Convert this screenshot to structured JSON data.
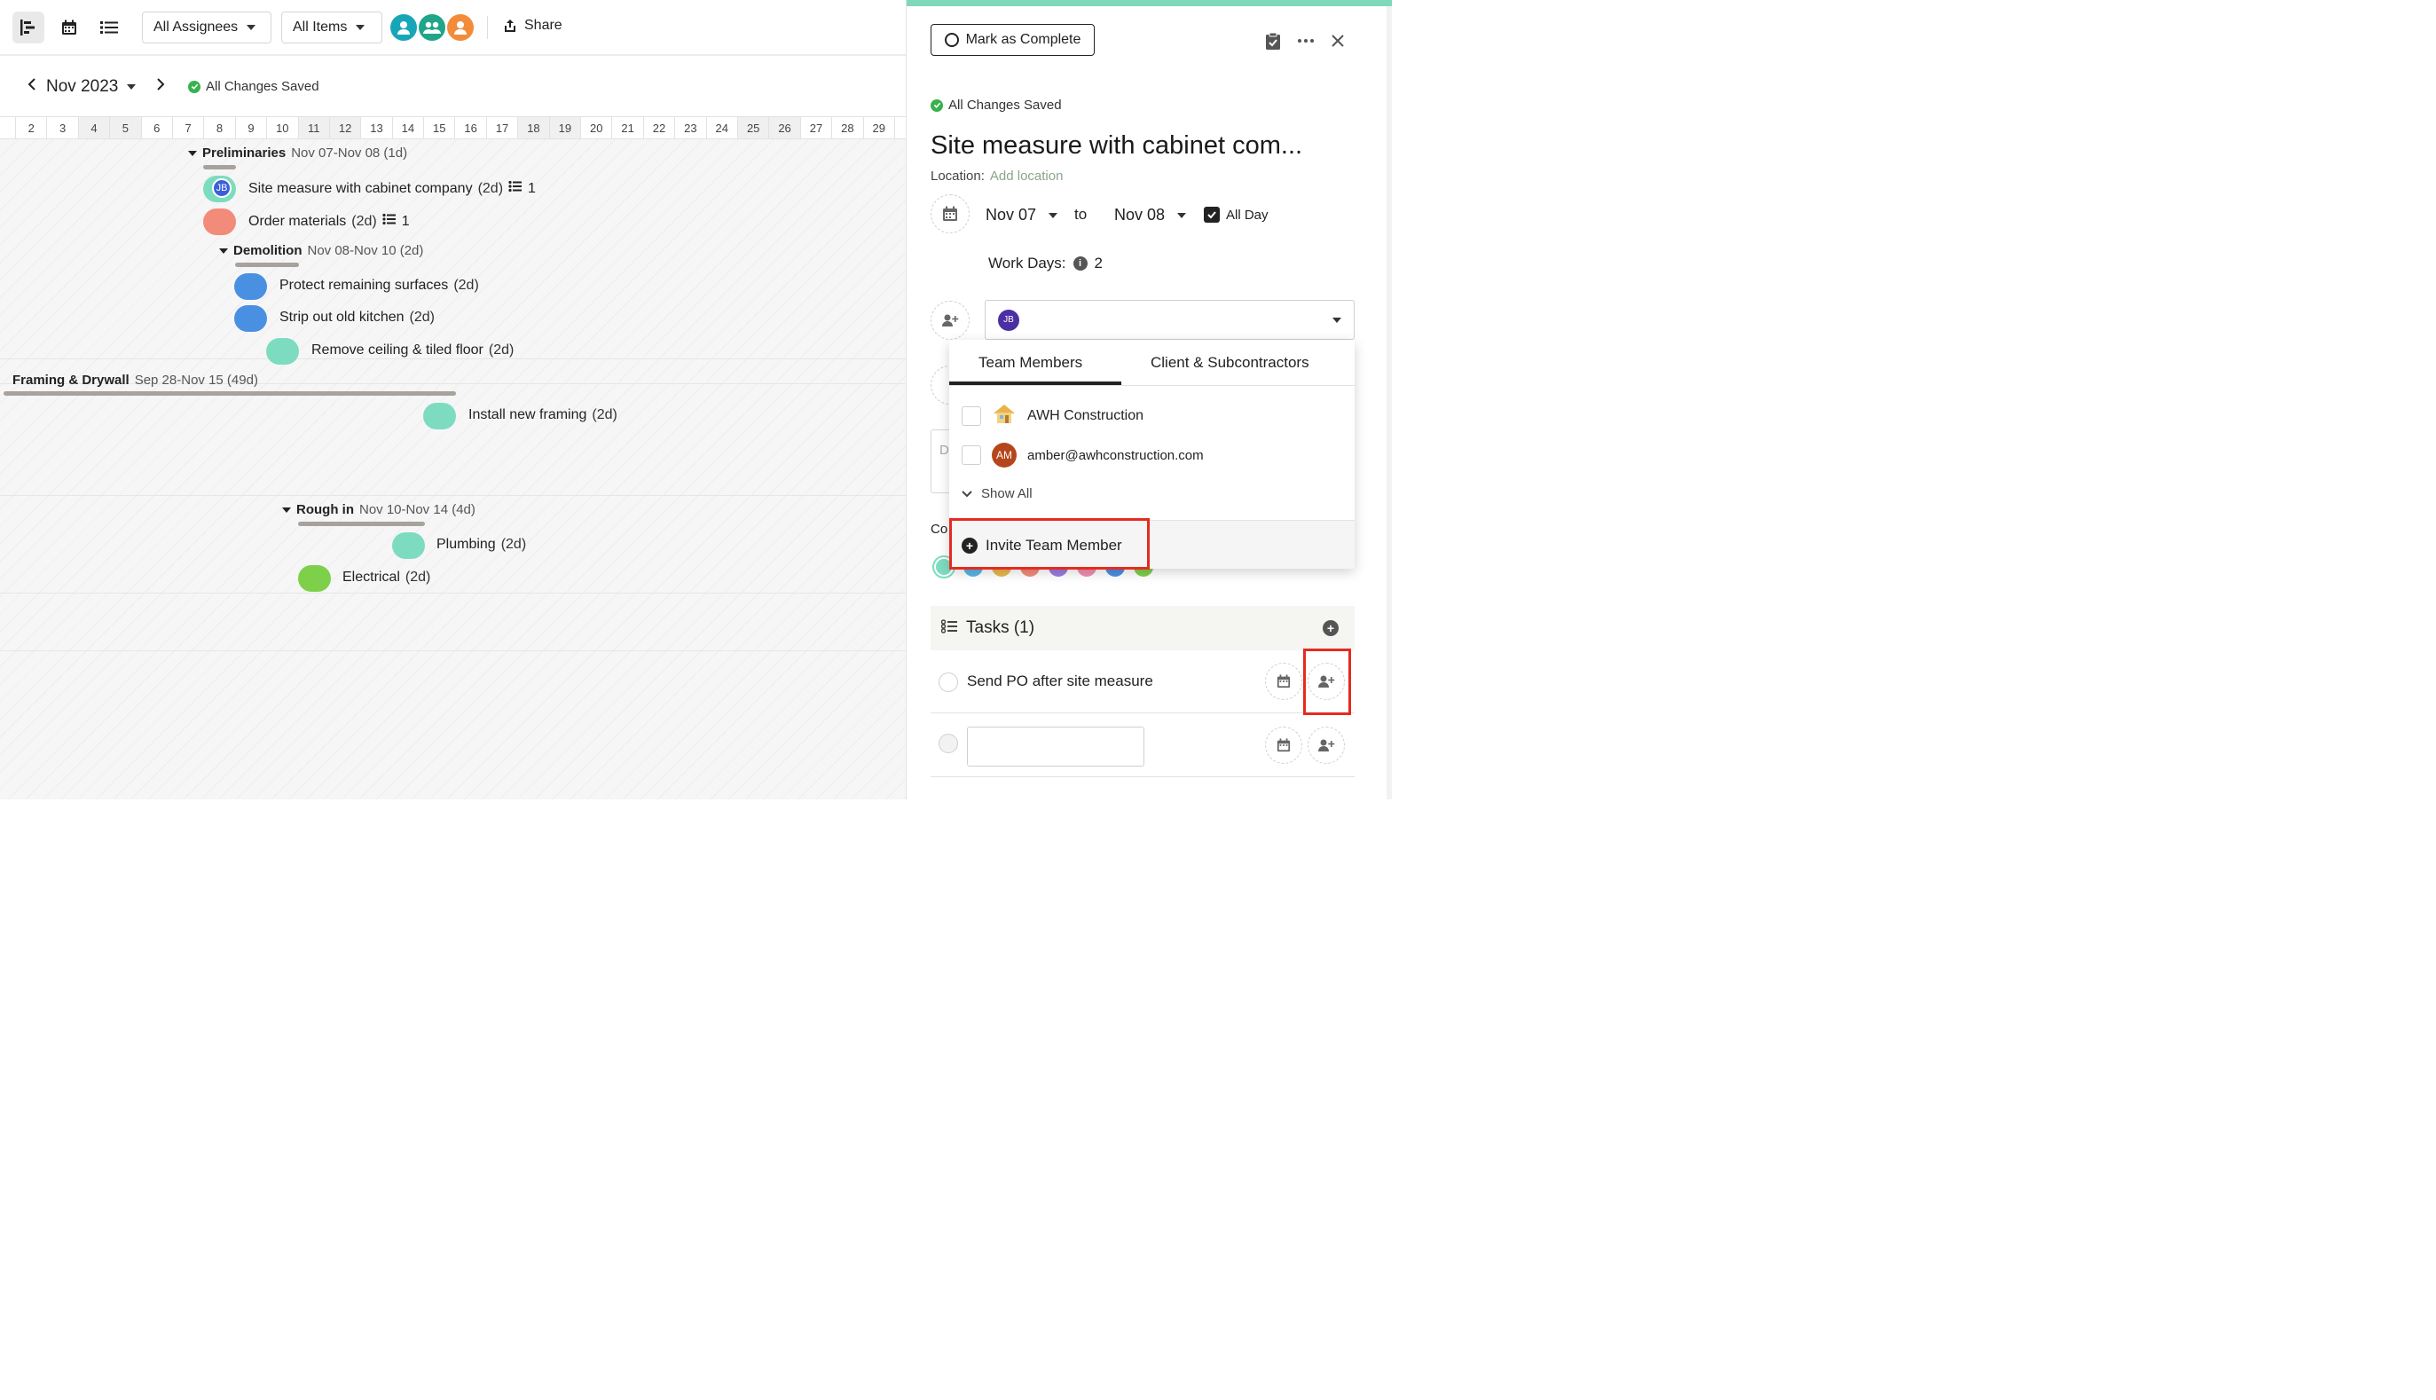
{
  "toolbar": {
    "assignees_label": "All Assignees",
    "items_label": "All Items",
    "share_label": "Share"
  },
  "gantt": {
    "month_label": "Nov 2023",
    "saved_label": "All Changes Saved",
    "days": [
      "2",
      "3",
      "4",
      "5",
      "6",
      "7",
      "8",
      "9",
      "10",
      "11",
      "12",
      "13",
      "14",
      "15",
      "16",
      "17",
      "18",
      "19",
      "20",
      "21",
      "22",
      "23",
      "24",
      "25",
      "26",
      "27",
      "28",
      "29"
    ],
    "groups": {
      "preliminaries": {
        "name": "Preliminaries",
        "range": "Nov 07-Nov 08 (1d)"
      },
      "demolition": {
        "name": "Demolition",
        "range": "Nov 08-Nov 10 (2d)"
      },
      "framing": {
        "name": "Framing & Drywall",
        "range": "Sep 28-Nov 15 (49d)"
      },
      "rough": {
        "name": "Rough in",
        "range": "Nov 10-Nov 14 (4d)"
      }
    },
    "items": {
      "site_measure": {
        "name": "Site measure with cabinet company",
        "dur": "(2d)",
        "tasks": "1",
        "badge": "JB"
      },
      "order_materials": {
        "name": "Order materials",
        "dur": "(2d)",
        "tasks": "1"
      },
      "protect": {
        "name": "Protect remaining surfaces",
        "dur": "(2d)"
      },
      "strip": {
        "name": "Strip out old kitchen",
        "dur": "(2d)"
      },
      "remove": {
        "name": "Remove ceiling & tiled floor",
        "dur": "(2d)"
      },
      "framing": {
        "name": "Install new framing",
        "dur": "(2d)"
      },
      "plumbing": {
        "name": "Plumbing",
        "dur": "(2d)"
      },
      "electrical": {
        "name": "Electrical",
        "dur": "(2d)"
      }
    }
  },
  "panel": {
    "mark_complete": "Mark as Complete",
    "saved_label": "All Changes Saved",
    "title": "Site measure with cabinet com...",
    "location_label": "Location:",
    "location_link": "Add location",
    "start_date": "Nov 07",
    "to_label": "to",
    "end_date": "Nov 08",
    "all_day": "All Day",
    "work_days_label": "Work Days:",
    "work_days_value": "2",
    "assignee_badge": "JB",
    "popup": {
      "tab_team": "Team Members",
      "tab_clients": "Client & Subcontractors",
      "option_company": "AWH Construction",
      "option_email": "amber@awhconstruction.com",
      "email_badge": "AM",
      "show_all": "Show All",
      "invite": "Invite Team Member"
    },
    "partial_co": "Co",
    "partial_d": "D",
    "tasks_title": "Tasks (1)",
    "task_1": "Send PO after site measure"
  },
  "colors": {
    "accent_mint": "#7fd8b9",
    "highlight_red": "#e52b1f",
    "pill_red": "#f28b7a",
    "pill_blue": "#4a90e2",
    "pill_mint": "#7ddcc0",
    "pill_green": "#7ed04b"
  }
}
